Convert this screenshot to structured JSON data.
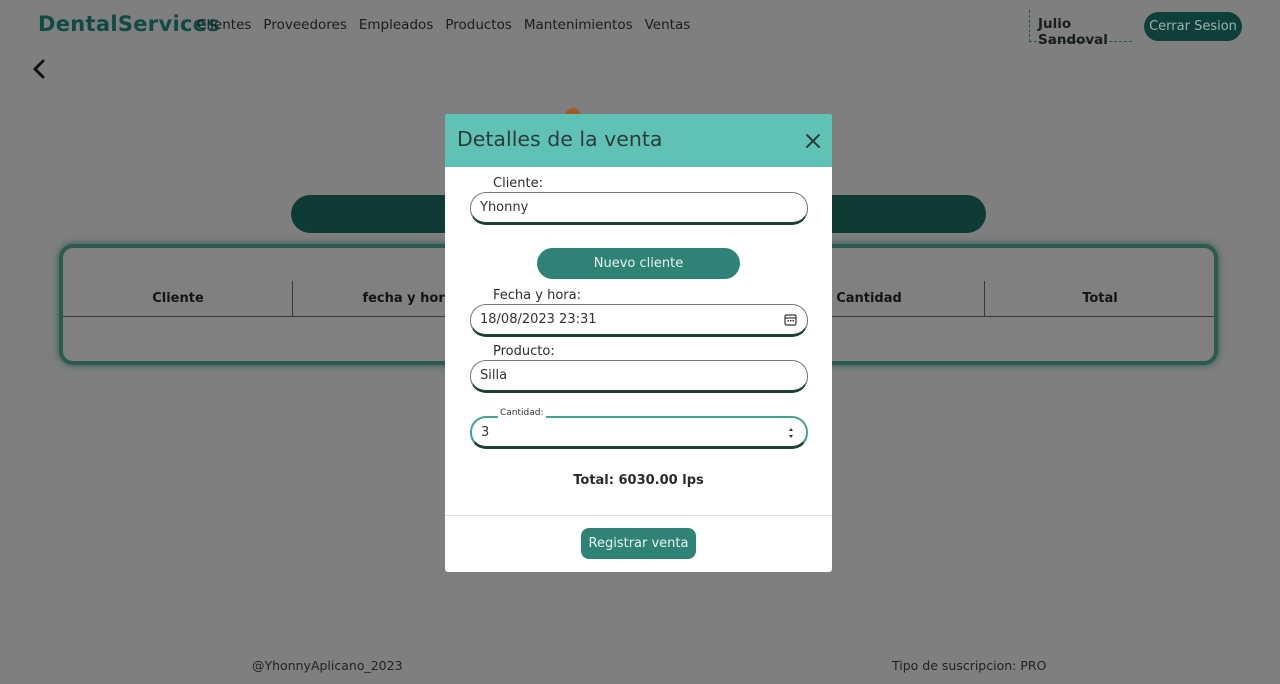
{
  "brand": "DentalServices",
  "nav": [
    "Clientes",
    "Proveedores",
    "Empleados",
    "Productos",
    "Mantenimientos",
    "Ventas"
  ],
  "user_name": "Julio Sandoval",
  "logout_label": "Cerrar Sesion",
  "icons": {
    "back": "chevron-left-icon",
    "close": "close-icon",
    "calendar": "calendar-icon",
    "spinner": "spinner-icon"
  },
  "colors": {
    "brand": "#0f4a44",
    "accent": "#5fc2b5",
    "button": "#2e8276",
    "dark_button": "#0f3f3a",
    "overlay": "#7f7f7f"
  },
  "table": {
    "headers": [
      "Cliente",
      "fecha y hora",
      "Cantidad",
      "Total"
    ]
  },
  "modal": {
    "title": "Detalles de la venta",
    "cliente_label": "Cliente:",
    "cliente_value": "Yhonny",
    "nuevo_cliente_label": "Nuevo cliente",
    "fecha_label": "Fecha y hora:",
    "fecha_value": "18/08/2023 23:31",
    "producto_label": "Producto:",
    "producto_value": "Silla",
    "cantidad_label": "Cantidad:",
    "cantidad_value": "3",
    "total_label": "Total:",
    "total_value": "6030.00 lps",
    "registrar_label": "Registrar venta"
  },
  "footer": {
    "handle": "@YhonnyAplicano_2023",
    "subscription": "Tipo de suscripcion: PRO"
  }
}
